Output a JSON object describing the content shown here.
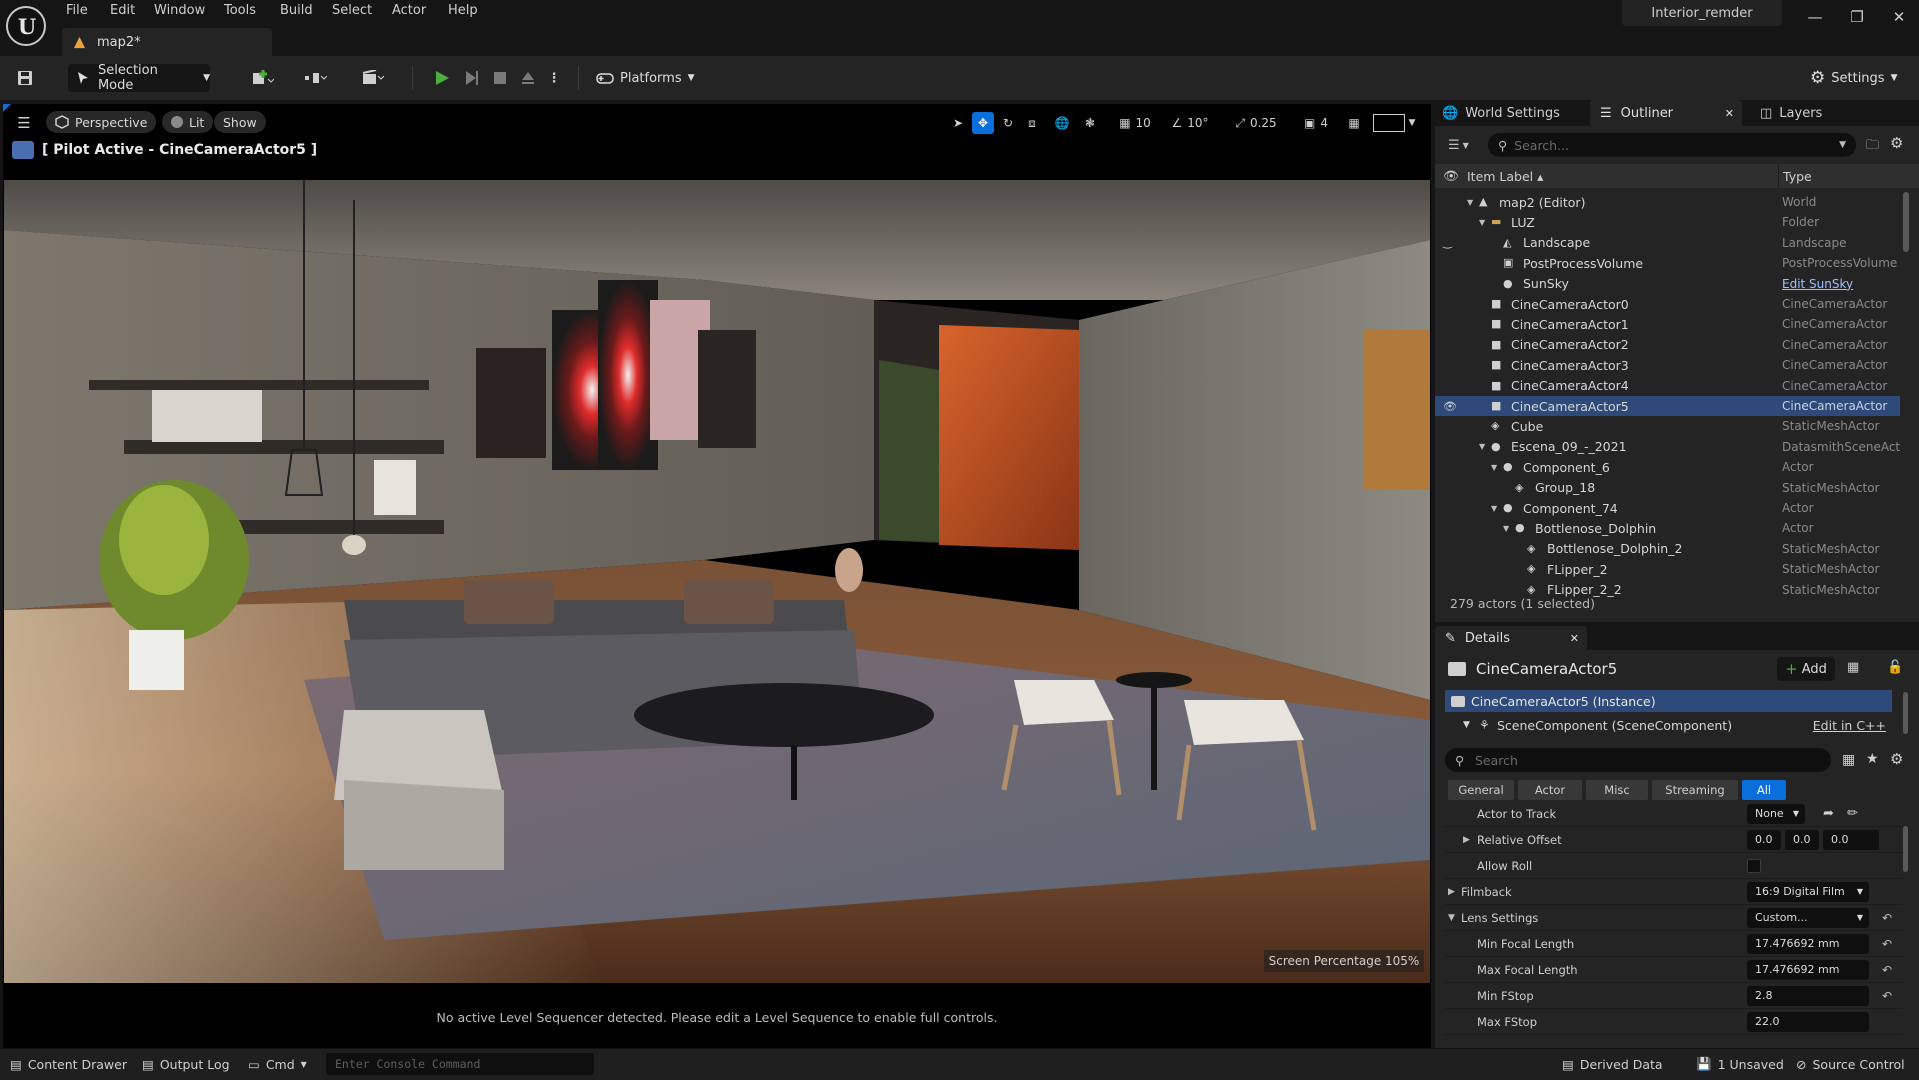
{
  "menu": {
    "items": [
      "File",
      "Edit",
      "Window",
      "Tools",
      "Build",
      "Select",
      "Actor",
      "Help"
    ],
    "map_tab": "map2*",
    "project": "Interior_remder"
  },
  "toolbar": {
    "selection_mode": "Selection Mode",
    "platforms": "Platforms",
    "settings": "Settings"
  },
  "viewport": {
    "view_mode": "Perspective",
    "lighting": "Lit",
    "show": "Show",
    "pilot_label": "[ Pilot Active - CineCameraActor5 ]",
    "grid_snap": "10",
    "rotation_snap": "10°",
    "scale_snap": "0.25",
    "camera_speed": "4",
    "screen_percentage": "Screen Percentage  105%",
    "sequencer_message": "No active Level Sequencer detected. Please edit a Level Sequence to enable full controls."
  },
  "panel_tabs": {
    "world_settings": "World Settings",
    "outliner": "Outliner",
    "layers": "Layers"
  },
  "outliner": {
    "search_placeholder": "Search...",
    "col_label": "Item Label ▴",
    "col_type": "Type",
    "rows": [
      {
        "label": "map2 (Editor)",
        "type": "World",
        "indent": 0,
        "icon": "world-icon",
        "expanded": true
      },
      {
        "label": "LUZ",
        "type": "Folder",
        "indent": 1,
        "icon": "folder-icon",
        "expanded": true
      },
      {
        "label": "Landscape",
        "type": "Landscape",
        "indent": 2,
        "icon": "landscape-icon"
      },
      {
        "label": "PostProcessVolume",
        "type": "PostProcessVolume",
        "indent": 2,
        "icon": "volume-icon"
      },
      {
        "label": "SunSky",
        "type": "Edit SunSky",
        "indent": 2,
        "icon": "sun-icon",
        "link": true
      },
      {
        "label": "CineCameraActor0",
        "type": "CineCameraActor",
        "indent": 1,
        "icon": "camera-icon"
      },
      {
        "label": "CineCameraActor1",
        "type": "CineCameraActor",
        "indent": 1,
        "icon": "camera-icon"
      },
      {
        "label": "CineCameraActor2",
        "type": "CineCameraActor",
        "indent": 1,
        "icon": "camera-icon"
      },
      {
        "label": "CineCameraActor3",
        "type": "CineCameraActor",
        "indent": 1,
        "icon": "camera-icon"
      },
      {
        "label": "CineCameraActor4",
        "type": "CineCameraActor",
        "indent": 1,
        "icon": "camera-icon"
      },
      {
        "label": "CineCameraActor5",
        "type": "CineCameraActor",
        "indent": 1,
        "icon": "camera-icon",
        "selected": true
      },
      {
        "label": "Cube",
        "type": "StaticMeshActor",
        "indent": 1,
        "icon": "mesh-icon"
      },
      {
        "label": "Escena_09_-_2021",
        "type": "DatasmithSceneActor",
        "indent": 1,
        "icon": "actor-icon",
        "expanded": true
      },
      {
        "label": "Component_6",
        "type": "Actor",
        "indent": 2,
        "icon": "actor-icon",
        "expanded": true
      },
      {
        "label": "Group_18",
        "type": "StaticMeshActor",
        "indent": 3,
        "icon": "mesh-icon"
      },
      {
        "label": "Component_74",
        "type": "Actor",
        "indent": 2,
        "icon": "actor-icon",
        "expanded": true
      },
      {
        "label": "Bottlenose_Dolphin",
        "type": "Actor",
        "indent": 3,
        "icon": "actor-icon",
        "expanded": true
      },
      {
        "label": "Bottlenose_Dolphin_2",
        "type": "StaticMeshActor",
        "indent": 4,
        "icon": "mesh-icon"
      },
      {
        "label": "FLipper_2",
        "type": "StaticMeshActor",
        "indent": 4,
        "icon": "mesh-icon"
      },
      {
        "label": "FLipper_2_2",
        "type": "StaticMeshActor",
        "indent": 4,
        "icon": "mesh-icon"
      }
    ],
    "footer": "279 actors (1 selected)"
  },
  "details": {
    "tab": "Details",
    "title": "CineCameraActor5",
    "add": "Add",
    "instance": "CineCameraActor5 (Instance)",
    "scene_component": "SceneComponent (SceneComponent)",
    "edit_cpp": "Edit in C++",
    "search_placeholder": "Search",
    "filters": [
      "General",
      "Actor",
      "Misc",
      "Streaming",
      "All"
    ],
    "active_filter": "All",
    "props": {
      "actor_to_track": {
        "name": "Actor to Track",
        "value": "None"
      },
      "relative_offset": {
        "name": "Relative Offset",
        "x": "0.0",
        "y": "0.0",
        "z": "0.0"
      },
      "allow_roll": {
        "name": "Allow Roll"
      },
      "filmback": {
        "name": "Filmback",
        "value": "16:9 Digital Film"
      },
      "lens_settings": {
        "name": "Lens Settings",
        "value": "Custom..."
      },
      "min_focal": {
        "name": "Min Focal Length",
        "value": "17.476692 mm"
      },
      "max_focal": {
        "name": "Max Focal Length",
        "value": "17.476692 mm"
      },
      "min_fstop": {
        "name": "Min FStop",
        "value": "2.8"
      },
      "max_fstop": {
        "name": "Max FStop",
        "value": "22.0"
      }
    }
  },
  "statusbar": {
    "content_drawer": "Content Drawer",
    "output_log": "Output Log",
    "cmd": "Cmd",
    "console_placeholder": "Enter Console Command",
    "derived_data": "Derived Data",
    "unsaved": "1 Unsaved",
    "source_control": "Source Control"
  },
  "colors": {
    "accent_blue": "#0a6fdc",
    "selection": "#2e4a7a",
    "play_green": "#4caf3c",
    "panel_bg": "#242424"
  }
}
